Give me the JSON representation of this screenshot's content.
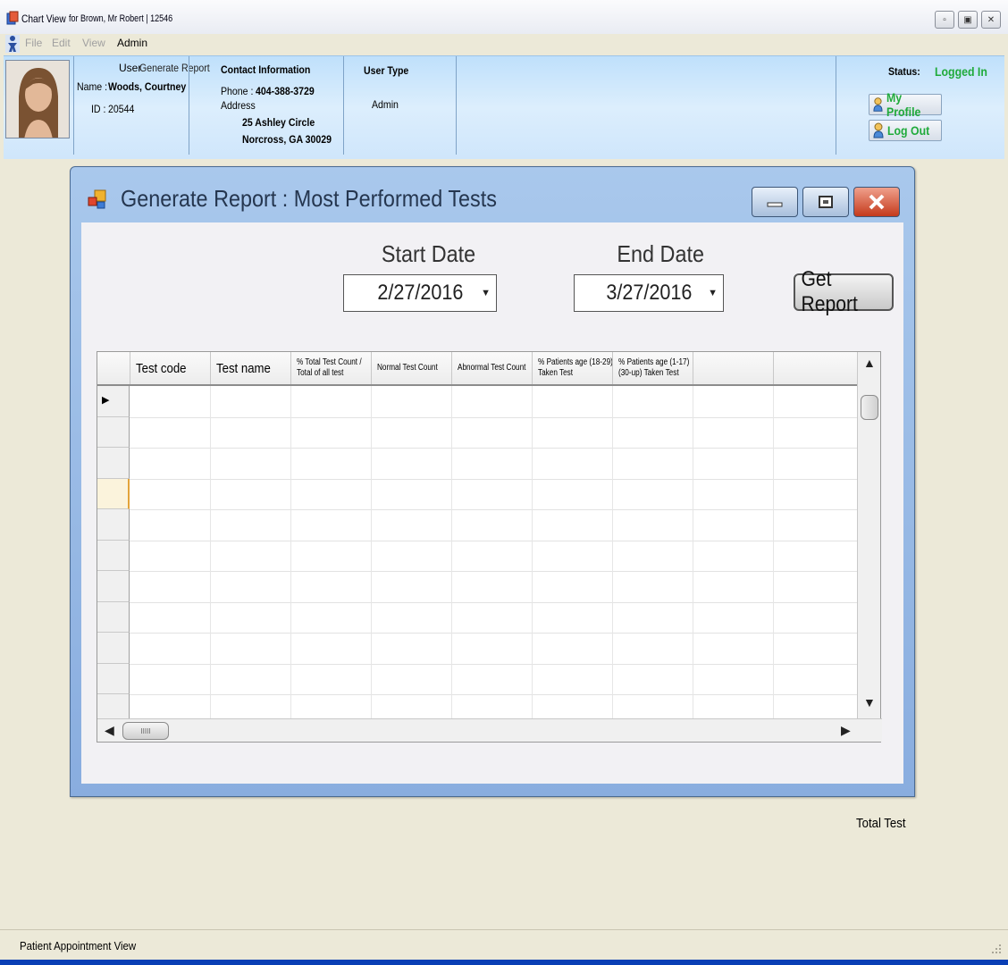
{
  "window": {
    "title": "Chart View",
    "subtitle": "for Brown, Mr Robert | 12546",
    "minimize_icon": "minimize-icon",
    "maximize_icon": "maximize-icon",
    "close_icon": "close-icon"
  },
  "menu": {
    "items": [
      "File",
      "Edit",
      "View",
      "Admin"
    ]
  },
  "header": {
    "user_label": "User",
    "generate_report_label": "Generate Report",
    "name_label": "Name :",
    "name_value": "Woods, Courtney",
    "id_label": "ID :",
    "id_value": "20544",
    "contact_title": "Contact Information",
    "phone_label": "Phone :",
    "phone_value": "404-388-3729",
    "address_label": "Address",
    "address_line1": "25 Ashley Circle",
    "address_line2": "Norcross, GA 30029",
    "user_type_title": "User Type",
    "user_type_value": "Admin",
    "status_label": "Status:",
    "status_value": "Logged In",
    "my_profile_label": "My Profile",
    "log_out_label": "Log Out",
    "status_color": "#1faa3a"
  },
  "dialog": {
    "title": "Generate Report :  Most Performed Tests",
    "start_date_label": "Start Date",
    "start_date_value": "2/27/2016",
    "end_date_label": "End Date",
    "end_date_value": "3/27/2016",
    "get_report_label": "Get Report"
  },
  "grid": {
    "columns": [
      "Test code",
      "Test name",
      "% Total Test Count /",
      "Total of all test",
      "Normal Test Count",
      "Abnormal Test Count",
      "% Patients age (18-29)",
      "Taken Test",
      "% Patients age (1-17)",
      "(30-up) Taken Test"
    ],
    "hscroll_thumb": "IIIII"
  },
  "total_test_label": "Total Test",
  "statusbar": {
    "text": "Patient Appointment View"
  }
}
